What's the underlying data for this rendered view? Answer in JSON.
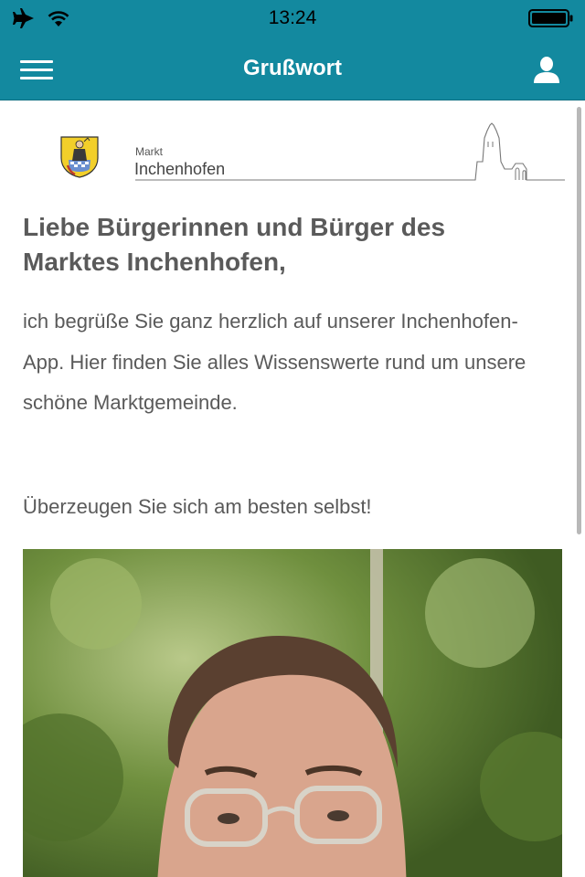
{
  "status_bar": {
    "time": "13:24",
    "icons": [
      "airplane-icon",
      "wifi-icon",
      "battery-icon"
    ]
  },
  "nav": {
    "title": "Grußwort",
    "menu_icon": "hamburger-menu-icon",
    "user_icon": "user-icon"
  },
  "logo": {
    "small_label": "Markt",
    "name": "Inchenhofen"
  },
  "article": {
    "heading": "Liebe Bürgerinnen und Bürger des Marktes Inchenhofen,",
    "paragraph1": "ich begrüße Sie ganz herzlich auf unserer Inchenhofen-App. Hier finden Sie alles Wissenswerte rund um unsere schöne Marktgemeinde.",
    "paragraph2": "Überzeugen Sie sich am besten selbst!"
  },
  "colors": {
    "primary": "#13899f",
    "text": "#5a5a5a",
    "background": "#ffffff"
  }
}
